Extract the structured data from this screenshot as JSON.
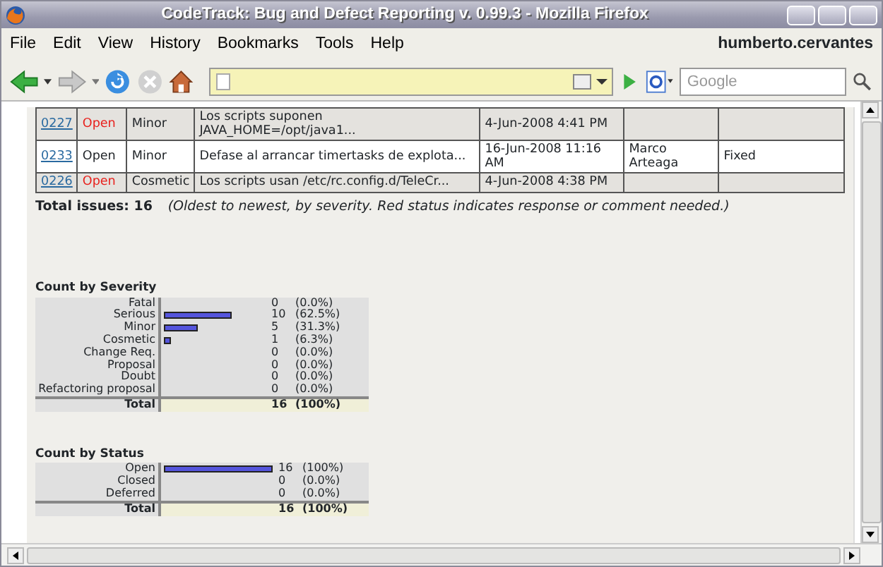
{
  "window": {
    "title": "CodeTrack: Bug and Defect Reporting v. 0.99.3 - Mozilla Firefox"
  },
  "menu": [
    "File",
    "Edit",
    "View",
    "History",
    "Bookmarks",
    "Tools",
    "Help"
  ],
  "user": "humberto.cervantes",
  "search": {
    "placeholder": "Google"
  },
  "issues": {
    "rows": [
      {
        "id": "0227",
        "status": "Open",
        "flagged": true,
        "severity": "Minor",
        "summary": "Los scripts suponen JAVA_HOME=/opt/java1...",
        "date": "4-Jun-2008 4:41 PM",
        "assignee": "",
        "resolution": ""
      },
      {
        "id": "0233",
        "status": "Open",
        "flagged": false,
        "severity": "Minor",
        "summary": "Defase al arrancar timertasks de explota...",
        "date": "16-Jun-2008 11:16 AM",
        "assignee": "Marco Arteaga",
        "resolution": "Fixed"
      },
      {
        "id": "0226",
        "status": "Open",
        "flagged": true,
        "severity": "Cosmetic",
        "summary": "Los scripts usan /etc/rc.config.d/TeleCr...",
        "date": "4-Jun-2008 4:38 PM",
        "assignee": "",
        "resolution": ""
      }
    ],
    "total": "Total issues: 16",
    "note": "(Oldest to newest, by severity. Red status indicates response or comment needed.)"
  },
  "stats": [
    {
      "title": "Count by Severity",
      "rows": [
        {
          "label": "Fatal",
          "count": "0",
          "percent": "(0.0%)"
        },
        {
          "label": "Serious",
          "count": "10",
          "percent": "(62.5%)",
          "level": 0.625
        },
        {
          "label": "Minor",
          "count": "5",
          "percent": "(31.3%)",
          "level": 0.313
        },
        {
          "label": "Cosmetic",
          "count": "1",
          "percent": "(6.3%)",
          "level": 0.063
        },
        {
          "label": "Change Req.",
          "count": "0",
          "percent": "(0.0%)"
        },
        {
          "label": "Proposal",
          "count": "0",
          "percent": "(0.0%)"
        },
        {
          "label": "Doubt",
          "count": "0",
          "percent": "(0.0%)"
        },
        {
          "label": "Refactoring proposal",
          "count": "0",
          "percent": "(0.0%)"
        }
      ],
      "total": {
        "label": "Total",
        "count": "16",
        "percent": "(100%)"
      }
    },
    {
      "title": "Count by Status",
      "rows": [
        {
          "label": "Open",
          "count": "16",
          "percent": "(100%)",
          "level": 1
        },
        {
          "label": "Closed",
          "count": "0",
          "percent": "(0.0%)"
        },
        {
          "label": "Deferred",
          "count": "0",
          "percent": "(0.0%)"
        }
      ],
      "total": {
        "label": "Total",
        "count": "16",
        "percent": "(100%)"
      }
    }
  ]
}
